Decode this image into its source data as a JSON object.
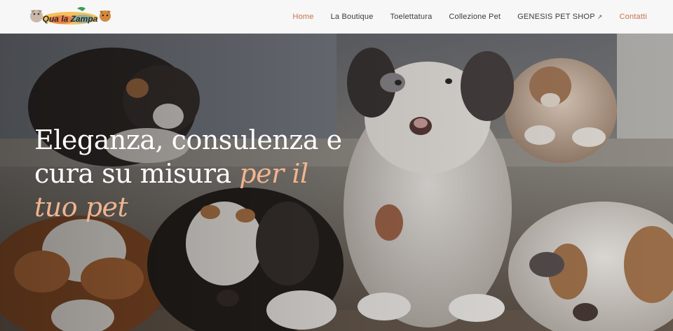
{
  "brand": {
    "logo_text": "Qua la Zampa",
    "colors": {
      "primary": "#c4734b",
      "accent_text": "#f0b48f",
      "header_bg": "#f7f7f7"
    }
  },
  "nav": {
    "items": [
      {
        "label": "Home",
        "active": true
      },
      {
        "label": "La Boutique"
      },
      {
        "label": "Toelettatura"
      },
      {
        "label": "Collezione Pet"
      },
      {
        "label": "GENESIS PET SHOP",
        "external_icon": "external-link-icon"
      },
      {
        "label": "Contatti"
      }
    ],
    "external_glyph": "↗"
  },
  "hero": {
    "title_part1": "Eleganza, consulenza e cura su misura",
    "title_accent": "per il tuo pet",
    "image": "puppies-photo"
  }
}
